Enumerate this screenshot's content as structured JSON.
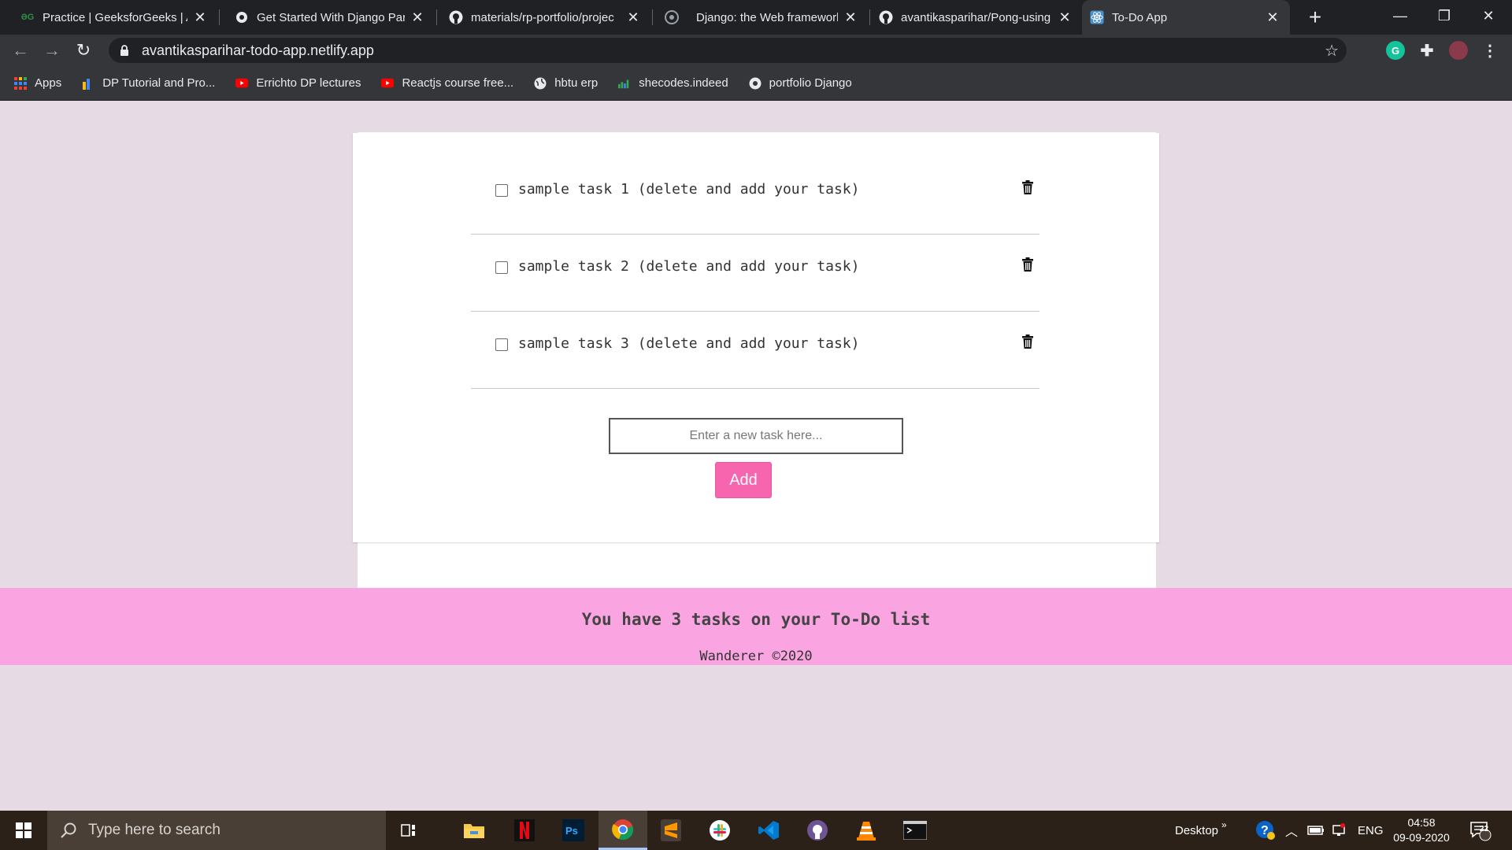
{
  "browser": {
    "tabs": [
      {
        "title": "Practice | GeeksforGeeks | A c",
        "favicon": "geeksforgeeks-icon",
        "active": false
      },
      {
        "title": "Get Started With Django Part",
        "favicon": "python-icon",
        "active": false
      },
      {
        "title": "materials/rp-portfolio/projec",
        "favicon": "github-icon",
        "active": false
      },
      {
        "title": "Django: the Web framework",
        "favicon": "django-icon",
        "active": false
      },
      {
        "title": "avantikasparihar/Pong-using",
        "favicon": "github-icon",
        "active": false
      },
      {
        "title": "To-Do App",
        "favicon": "react-icon",
        "active": true
      }
    ],
    "url": "avantikasparihar-todo-app.netlify.app",
    "bookmarks": [
      {
        "label": "Apps",
        "icon": "apps-grid-icon"
      },
      {
        "label": "DP Tutorial and Pro...",
        "icon": "bookmark-chart-icon"
      },
      {
        "label": "Errichto DP lectures",
        "icon": "youtube-icon"
      },
      {
        "label": "Reactjs course free...",
        "icon": "youtube-icon"
      },
      {
        "label": "hbtu erp",
        "icon": "globe-icon"
      },
      {
        "label": "shecodes.indeed",
        "icon": "bookmark-bars-icon"
      },
      {
        "label": "portfolio Django",
        "icon": "python-icon"
      }
    ]
  },
  "todo": {
    "tasks": [
      {
        "text": "sample task 1 (delete and add your task)",
        "done": false
      },
      {
        "text": "sample task 2 (delete and add your task)",
        "done": false
      },
      {
        "text": "sample task 3 (delete and add your task)",
        "done": false
      }
    ],
    "input_placeholder": "Enter a new task here...",
    "add_label": "Add",
    "count_text": "You have 3 tasks on your To-Do list",
    "credit": "Wanderer ©2020"
  },
  "taskbar": {
    "search_placeholder": "Type here to search",
    "apps": [
      "task-view-icon",
      "file-explorer-icon",
      "netflix-icon",
      "photoshop-icon",
      "chrome-icon",
      "sublime-text-icon",
      "slack-icon",
      "vscode-icon",
      "github-desktop-icon",
      "vlc-icon",
      "terminal-icon"
    ],
    "desktop_label": "Desktop",
    "language": "ENG",
    "time": "04:58",
    "date": "09-09-2020",
    "notifications": "22"
  },
  "colors": {
    "page_bg": "#e6dae5",
    "footer_bg": "#fba4e2",
    "add_button": "#f765ae",
    "chrome_dark": "#202124",
    "chrome_mid": "#35363a"
  }
}
